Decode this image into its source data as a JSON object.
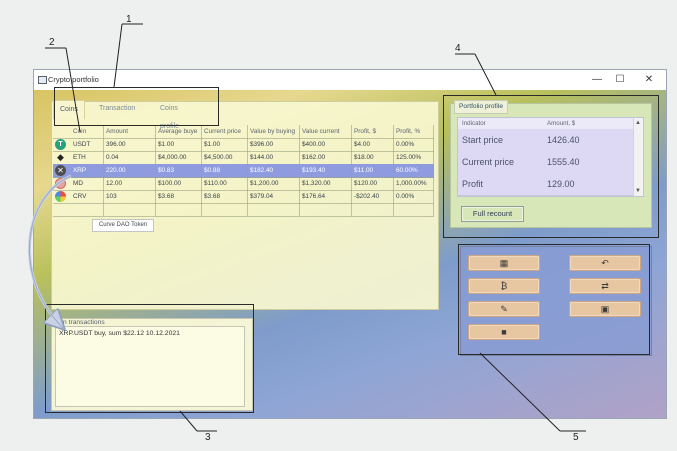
{
  "callouts": [
    "1",
    "2",
    "3",
    "4",
    "5"
  ],
  "window": {
    "title": "Crypto portfolio",
    "controls": {
      "minimize": "—",
      "maximize": "☐",
      "close": "✕"
    }
  },
  "tabs": {
    "coins": "Coins",
    "transaction": "Transaction",
    "coins_profile": "Coins profile"
  },
  "coin_table": {
    "headers": [
      "Coin",
      "Amount",
      "Average buye",
      "Current price",
      "Value by buying",
      "Value current",
      "Profit, $",
      "Profit, %"
    ],
    "rows": [
      {
        "coin": "USDT",
        "amount": "396.00",
        "avg": "$1.00",
        "current": "$1.00",
        "value_buy": "$396.00",
        "value_current": "$400.00",
        "profit_usd": "$4.00",
        "profit_pct": "0.00%"
      },
      {
        "coin": "ETH",
        "amount": "0.04",
        "avg": "$4,000.00",
        "current": "$4,500.00",
        "value_buy": "$144.00",
        "value_current": "$162.00",
        "profit_usd": "$18.00",
        "profit_pct": "125.00%"
      },
      {
        "coin": "XRP",
        "amount": "220.00",
        "avg": "$0.83",
        "current": "$0.88",
        "value_buy": "$182.40",
        "value_current": "$193.40",
        "profit_usd": "$11.00",
        "profit_pct": "60.00%"
      },
      {
        "coin": "MD",
        "amount": "12.00",
        "avg": "$100.00",
        "current": "$110.00",
        "value_buy": "$1,200.00",
        "value_current": "$1,320.00",
        "profit_usd": "$120.00",
        "profit_pct": "1,000.00%"
      },
      {
        "coin": "CRV",
        "amount": "103",
        "avg": "$3.68",
        "current": "$3.68",
        "value_buy": "$379.04",
        "value_current": "$176.64",
        "profit_usd": "-$202.40",
        "profit_pct": "0.00%"
      }
    ],
    "tooltip": "Curve DAO Token"
  },
  "transactions": {
    "title": "Coin transactions",
    "line": "XRP.USDT  buy, sum $22.12  10.12.2021"
  },
  "portfolio_profile": {
    "tab": "Portfolio profile",
    "headers": {
      "indicator": "Indicator",
      "amount": "Amount, $"
    },
    "rows": [
      {
        "indicator": "Start price",
        "amount": "1426.40"
      },
      {
        "indicator": "Current price",
        "amount": "1555.40"
      },
      {
        "indicator": "Profit",
        "amount": "129.00"
      }
    ],
    "full_recount": "Full recount"
  },
  "action_icons": [
    "calculator-icon",
    "undo-icon",
    "bitcoin-icon",
    "swap-icon",
    "edit-icon",
    "wallet-icon",
    "trash-icon"
  ],
  "colors": {
    "selected_row": "#8f9bdf",
    "action_button": "#e7c7a2",
    "portfolio_panel": "#d7e7b8"
  }
}
